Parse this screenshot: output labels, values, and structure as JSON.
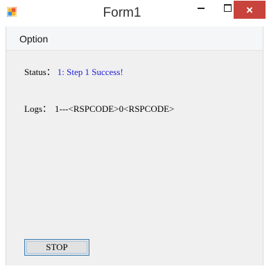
{
  "window": {
    "title": "Form1",
    "icon": "app-icon",
    "controls": {
      "minimize": "minimize-icon",
      "maximize": "maximize-icon",
      "close_label": "×"
    },
    "close_color": "#c7433b"
  },
  "menu": {
    "items": [
      {
        "label": "Option"
      }
    ]
  },
  "status": {
    "label": "Status：",
    "value": "1: Step 1 Success!",
    "value_color": "#1c1cd6"
  },
  "logs": {
    "label": "Logs：",
    "value": "1---<RSPCODE>0<RSPCODE>"
  },
  "stop_button": {
    "label": "STOP"
  }
}
